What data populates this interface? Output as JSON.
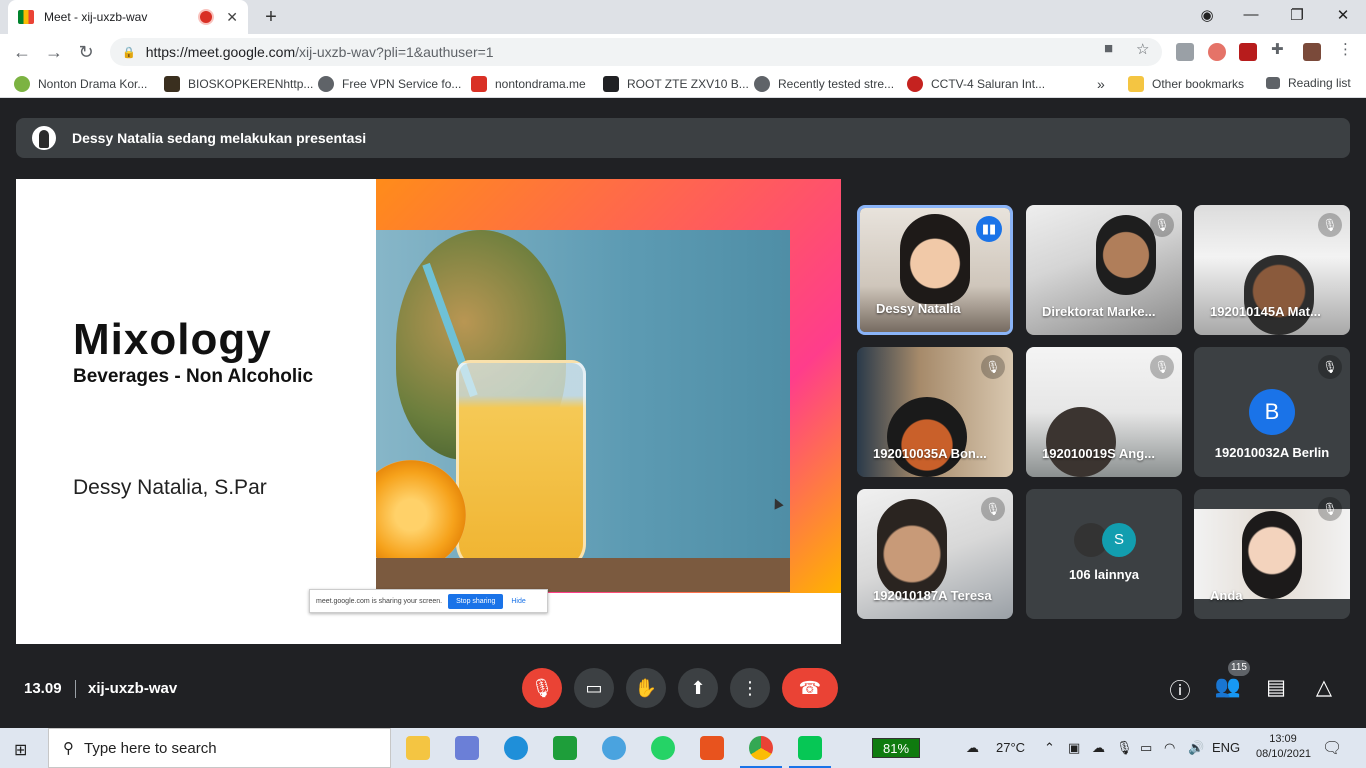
{
  "browser": {
    "tab_title": "Meet - xij-uxzb-wav",
    "tab_close": "✕",
    "new_tab": "+",
    "url_host": "https://meet.google.com",
    "url_path": "/xij-uxzb-wav?pli=1&authuser=1",
    "window_min": "—",
    "window_restore": "❐",
    "window_close": "✕",
    "bookmarks": [
      {
        "label": "Nonton Drama Kor...",
        "color": "#7cb342"
      },
      {
        "label": "BIOSKOPKERENhttp...",
        "color": "#3a2f1f"
      },
      {
        "label": "Free VPN Service fo...",
        "color": "#5f6368"
      },
      {
        "label": "nontondrama.me",
        "color": "#d93025"
      },
      {
        "label": "ROOT ZTE ZXV10 B...",
        "color": "#202124"
      },
      {
        "label": "Recently tested stre...",
        "color": "#5f6368"
      },
      {
        "label": "CCTV-4 Saluran Int...",
        "color": "#c5221f"
      },
      {
        "label": "Other bookmarks",
        "color": "#f4c542"
      },
      {
        "label": "Reading list",
        "color": "#5f6368"
      }
    ],
    "bookmarks_overflow": "»"
  },
  "meet": {
    "presenting_banner": "Dessy Natalia sedang melakukan presentasi",
    "slide": {
      "title": "Mixology",
      "subtitle": "Beverages - Non Alcoholic",
      "author": "Dessy Natalia, S.Par",
      "share_text": "meet.google.com is sharing your screen.",
      "stop_sharing": "Stop sharing",
      "hide": "Hide"
    },
    "participants": [
      {
        "name": "Dessy Natalia",
        "speaking": true
      },
      {
        "name": "Direktorat Marke...",
        "speaking": false
      },
      {
        "name": "192010145A Mat...",
        "speaking": false
      },
      {
        "name": "192010035A Bon...",
        "speaking": false
      },
      {
        "name": "192010019S Ang...",
        "speaking": false
      },
      {
        "name": "192010032A Berlin",
        "initial": "B",
        "speaking": false
      },
      {
        "name": "192010187A Teresa",
        "speaking": false
      },
      {
        "name": "106 lainnya",
        "initial": "S"
      },
      {
        "name": "Anda",
        "speaking": false
      }
    ],
    "time": "13.09",
    "meeting_code": "xij-uxzb-wav",
    "participant_count": "115"
  },
  "taskbar": {
    "search_placeholder": "Type here to search",
    "battery": "81%",
    "weather": "27°C",
    "lang": "ENG",
    "time": "13:09",
    "date": "08/10/2021"
  }
}
